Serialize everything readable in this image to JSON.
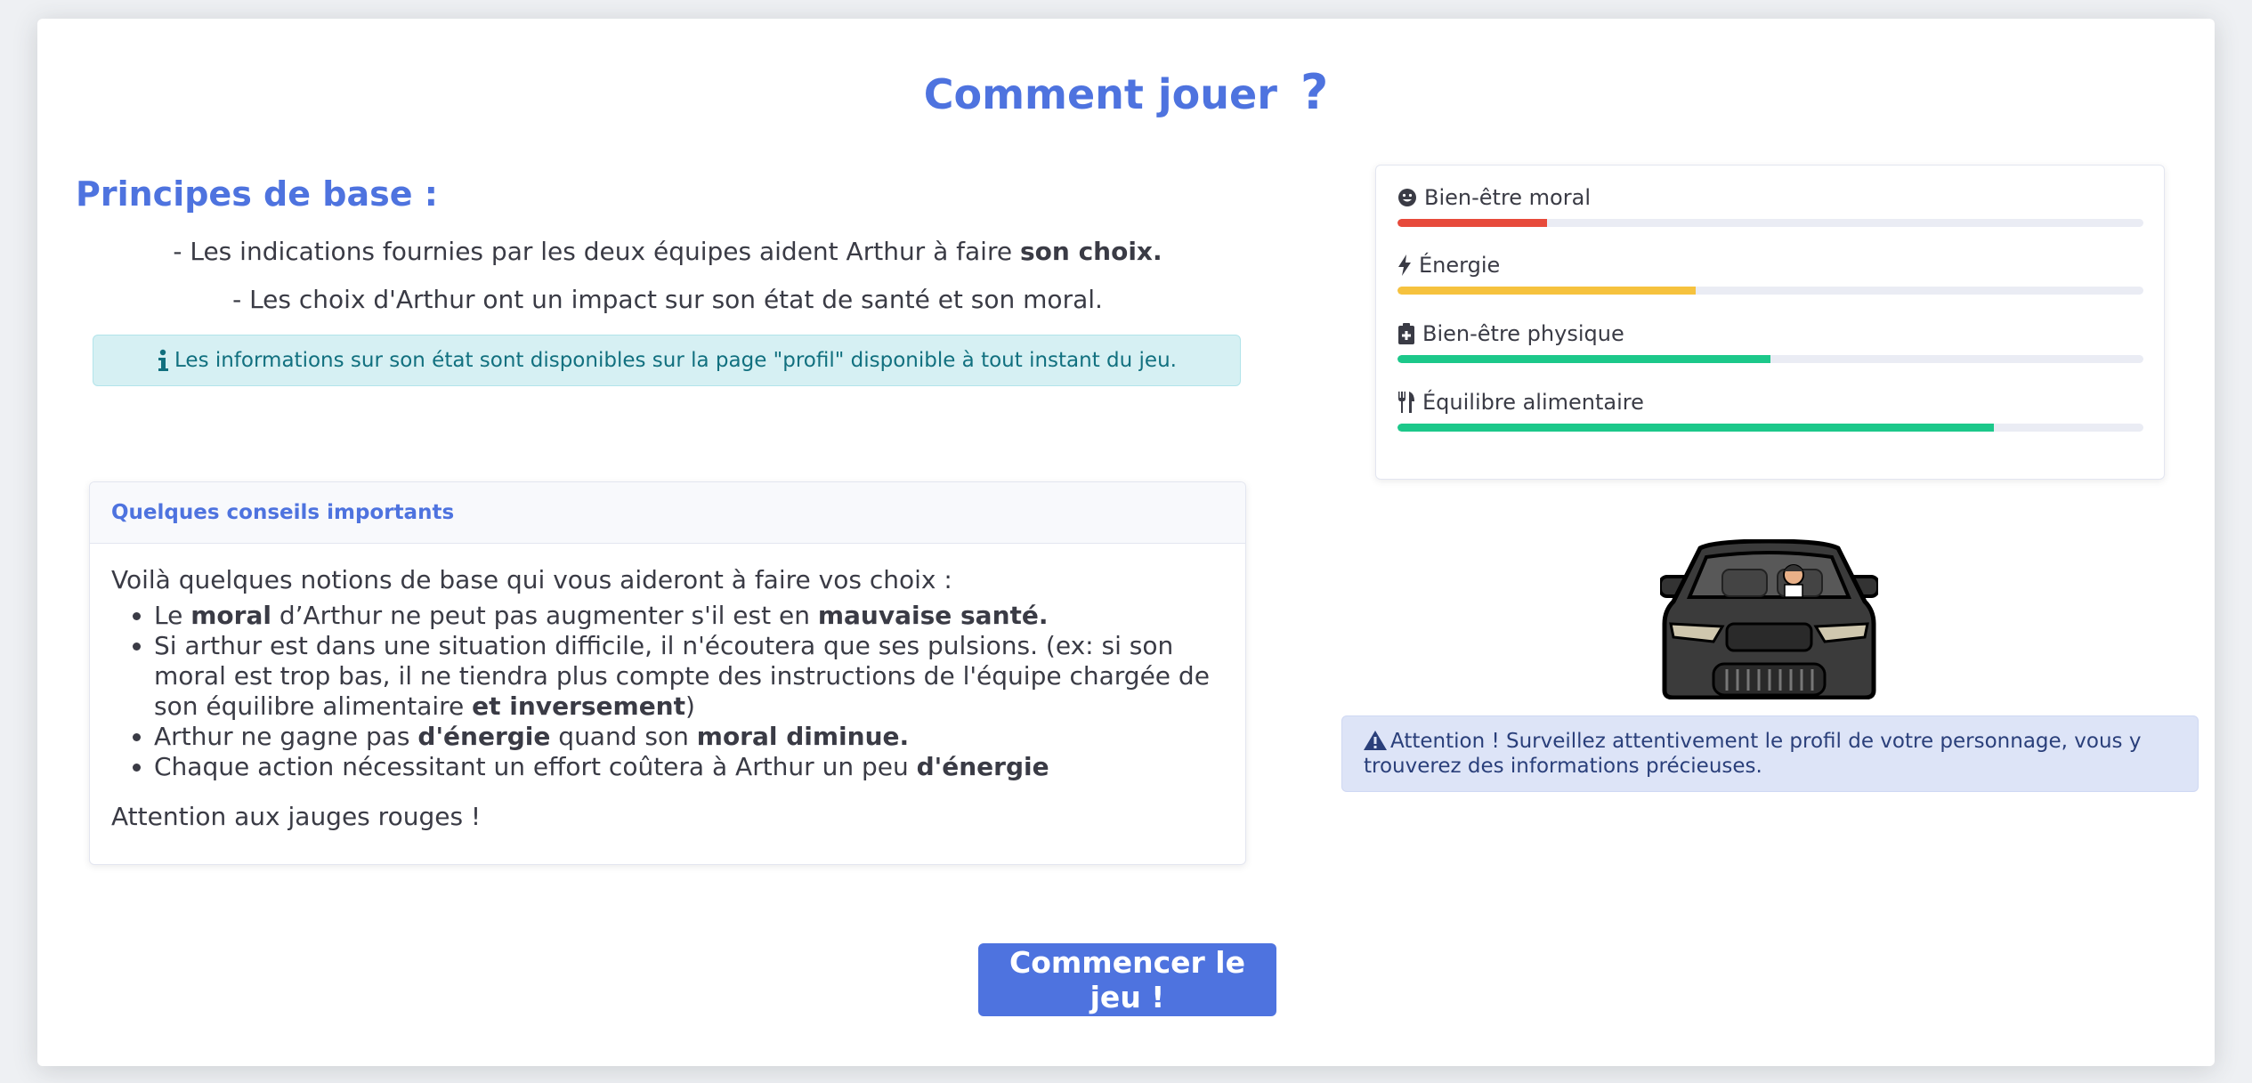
{
  "page": {
    "title": "Comment jouer",
    "title_icon": "question-mark-icon"
  },
  "basics": {
    "heading": "Principes de base :",
    "line1_text": "- Les indications fournies par les deux équipes aident Arthur à faire ",
    "line1_bold": "son choix.",
    "line2": "- Les choix d'Arthur ont un impact sur son état de santé et son moral.",
    "info_alert": "Les informations sur son état sont disponibles sur la page \"profil\" disponible à tout instant du jeu."
  },
  "tips": {
    "header": "Quelques conseils importants",
    "intro": "Voilà quelques notions de base qui vous aideront à faire vos choix :",
    "items": [
      [
        "Le ",
        "moral",
        " d’Arthur ne peut pas augmenter s'il est en ",
        "mauvaise santé.",
        ""
      ],
      [
        "Si arthur est dans une situation difficile, il n'écoutera que ses pulsions. (ex: si son moral est trop bas, il ne tiendra plus compte des instructions de l'équipe chargée de son équilibre alimentaire ",
        "et inversement",
        ")",
        "",
        ""
      ],
      [
        "Arthur ne gagne pas ",
        "d'énergie",
        " quand son ",
        "moral diminue.",
        ""
      ],
      [
        "Chaque action nécessitant un effort coûtera à Arthur un peu ",
        "d'énergie",
        "",
        "",
        ""
      ]
    ],
    "outro": "Attention aux jauges rouges !"
  },
  "stats": [
    {
      "label": "Bien-être moral",
      "icon": "smiley-icon",
      "value": 0.2,
      "color": "#e74a3b"
    },
    {
      "label": "Énergie",
      "icon": "lightning-icon",
      "value": 0.4,
      "color": "#f6c23e"
    },
    {
      "label": "Bien-être physique",
      "icon": "medical-clipboard-icon",
      "value": 0.5,
      "color": "#1cc88a"
    },
    {
      "label": "Équilibre alimentaire",
      "icon": "utensils-icon",
      "value": 0.8,
      "color": "#1cc88a"
    }
  ],
  "warning": {
    "icon": "warning-triangle-icon",
    "text": "Attention ! Surveillez attentivement le profil de votre personnage, vous y trouverez des informations précieuses."
  },
  "start_button": "Commencer le jeu !",
  "colors": {
    "primary": "#4e73df",
    "info_bg": "#d6f0f3",
    "info_text": "#11707f",
    "warning_bg": "#dde4f7"
  }
}
